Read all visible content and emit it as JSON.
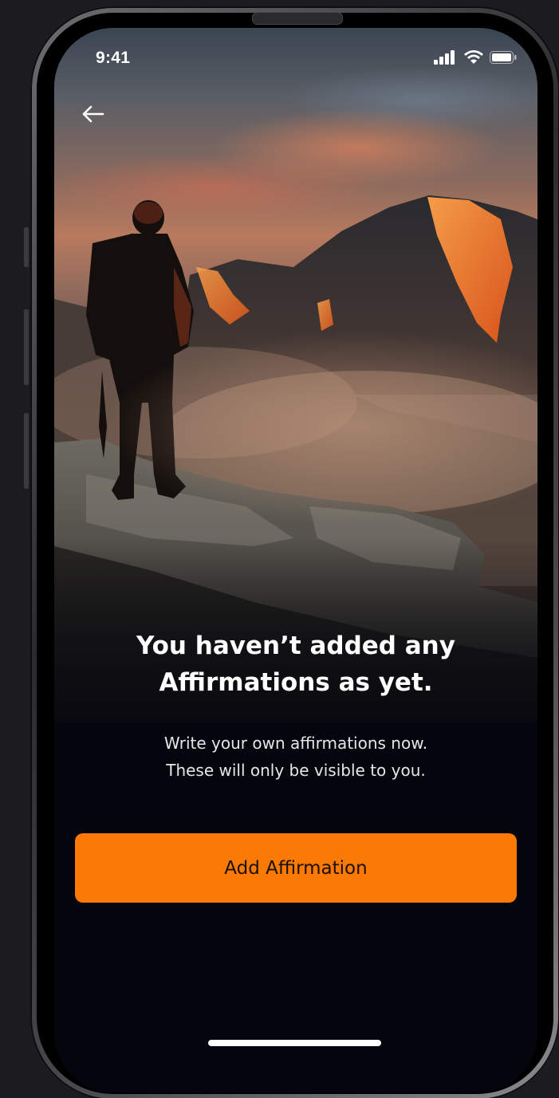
{
  "status_bar": {
    "time": "9:41",
    "icons": [
      "signal-icon",
      "wifi-icon",
      "battery-icon"
    ]
  },
  "navigation": {
    "back_icon": "arrow-left-icon"
  },
  "empty_state": {
    "title": "You haven’t added any Affirmations as yet.",
    "description": "Write your own affirmations now.\nThese will only be visible to you.",
    "hero_image": "hiker-on-mountain-ridge"
  },
  "actions": {
    "add_label": "Add Affirmation"
  },
  "colors": {
    "accent": "#fb7a05",
    "background": "#05060d",
    "text": "#ffffff"
  }
}
